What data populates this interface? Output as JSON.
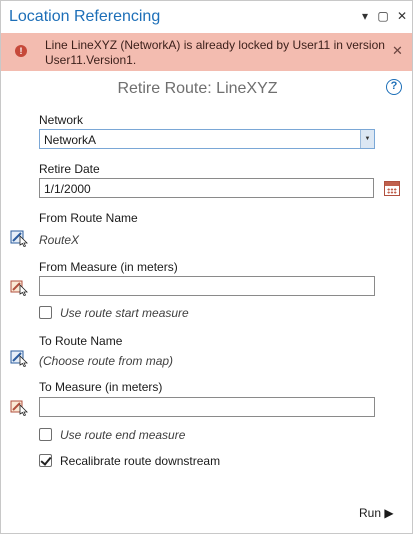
{
  "pane": {
    "title": "Location Referencing",
    "controls": {
      "options_icon": "▾",
      "maximize_icon": "▢",
      "close_icon": "✕"
    }
  },
  "error_banner": {
    "message": "Line LineXYZ (NetworkA) is already locked by User11 in version User11.Version1.",
    "icon_glyph": "!",
    "close_icon": "✕"
  },
  "tool": {
    "heading": "Retire Route: LineXYZ",
    "help_glyph": "?"
  },
  "network": {
    "label": "Network",
    "value": "NetworkA",
    "dropdown_glyph": "▼"
  },
  "retire_date": {
    "label": "Retire Date",
    "value": "1/1/2000"
  },
  "from_route": {
    "label": "From Route Name",
    "value": "RouteX"
  },
  "from_measure": {
    "label": "From Measure (in meters)",
    "value": ""
  },
  "use_start": {
    "label": "Use route start measure",
    "checked": false
  },
  "to_route": {
    "label": "To Route Name",
    "value": "(Choose route from map)"
  },
  "to_measure": {
    "label": "To Measure (in meters)",
    "value": ""
  },
  "use_end": {
    "label": "Use route end measure",
    "checked": false
  },
  "recalibrate": {
    "label": "Recalibrate route downstream",
    "checked": true
  },
  "run_button": {
    "label": "Run ▶"
  },
  "colors": {
    "accent": "#1d6fb8",
    "error_bg": "#f3bcb0",
    "error_icon": "#c6493a"
  }
}
